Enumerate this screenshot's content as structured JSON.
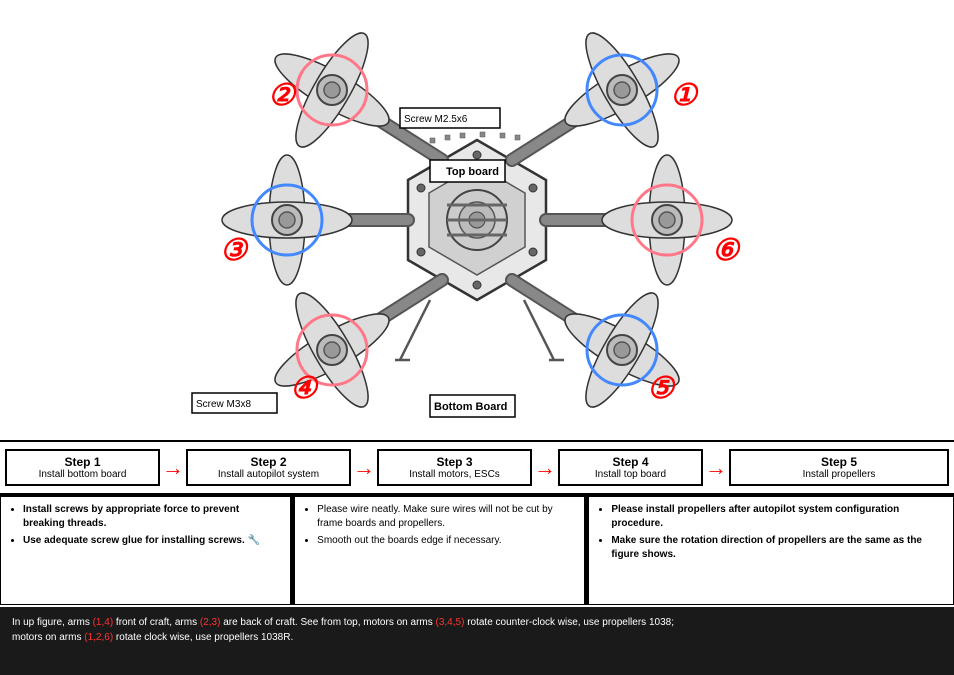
{
  "diagram": {
    "labels": {
      "screw_top": "Screw M2.5x6",
      "top_board": "Top board",
      "screw_bottom": "Screw M3x8",
      "bottom_board": "Bottom Board"
    },
    "motor_numbers": [
      "1",
      "2",
      "3",
      "4",
      "5",
      "6"
    ]
  },
  "steps": [
    {
      "id": "step1",
      "title": "Step 1",
      "desc": "Install bottom board"
    },
    {
      "id": "step2",
      "title": "Step 2",
      "desc": "Install autopilot system"
    },
    {
      "id": "step3",
      "title": "Step 3",
      "desc": "Install motors, ESCs"
    },
    {
      "id": "step4",
      "title": "Step 4",
      "desc": "Install top board"
    },
    {
      "id": "step5",
      "title": "Step 5",
      "desc": "Install propellers"
    }
  ],
  "notes": {
    "left": [
      "Install screws by appropriate force to prevent breaking threads.",
      "Use adequate screw glue for installing screws."
    ],
    "middle": [
      "Please wire neatly. Make sure wires will not be cut by frame boards and propellers.",
      "Smooth out the boards edge if necessary."
    ],
    "right": [
      "Please install propellers after autopilot system configuration procedure.",
      "Make sure the rotation direction of propellers are the same as the figure shows."
    ]
  },
  "bottom_text": "In up figure, arms (1,4) front of craft, arms (2,3) are back of craft. See from top, motors on arms (3,4,5) rotate counter-clock wise, use propellers 1038; motors on arms (1,2,6) rotate clock wise, use propellers 1038R.",
  "arrows": {
    "label": "→"
  }
}
